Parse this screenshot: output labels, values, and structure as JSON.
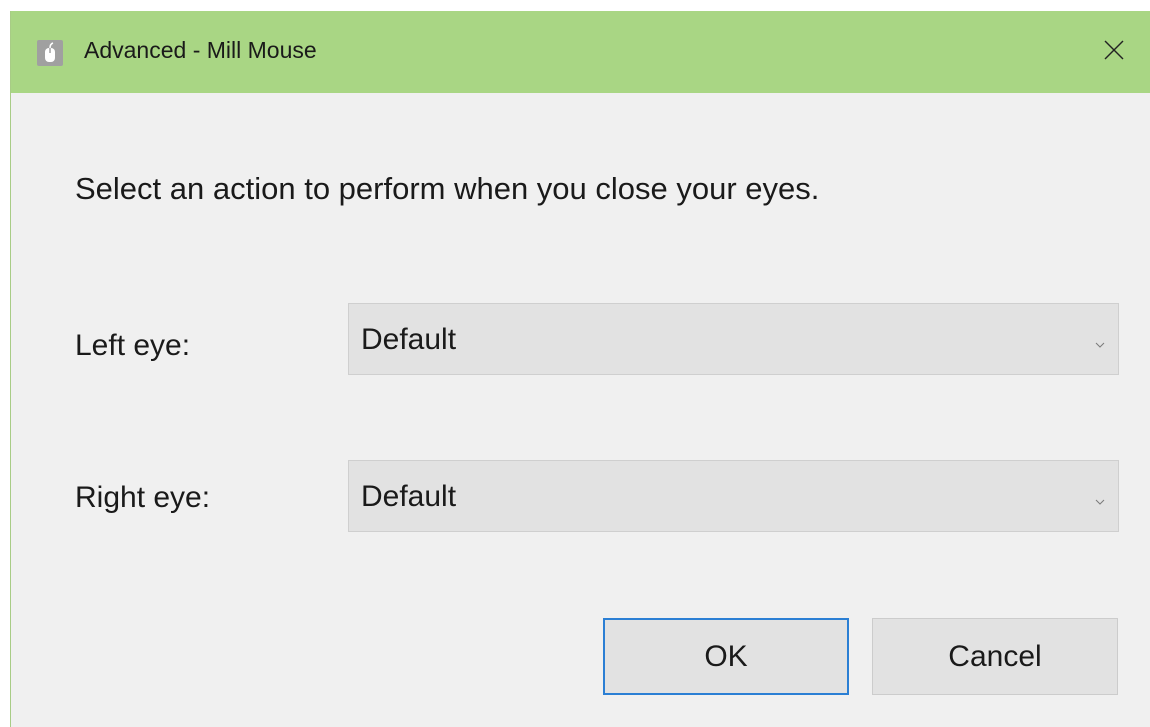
{
  "window": {
    "title": "Advanced - Mill Mouse",
    "app_icon": "mouse-icon",
    "close_icon": "close-icon",
    "accent_color": "#a9d684"
  },
  "dialog": {
    "instruction": "Select an action to perform when you close your eyes.",
    "left_eye": {
      "label": "Left eye:",
      "selected": "Default"
    },
    "right_eye": {
      "label": "Right eye:",
      "selected": "Default"
    }
  },
  "buttons": {
    "ok_label": "OK",
    "cancel_label": "Cancel",
    "focus_color": "#2b7fd4"
  }
}
